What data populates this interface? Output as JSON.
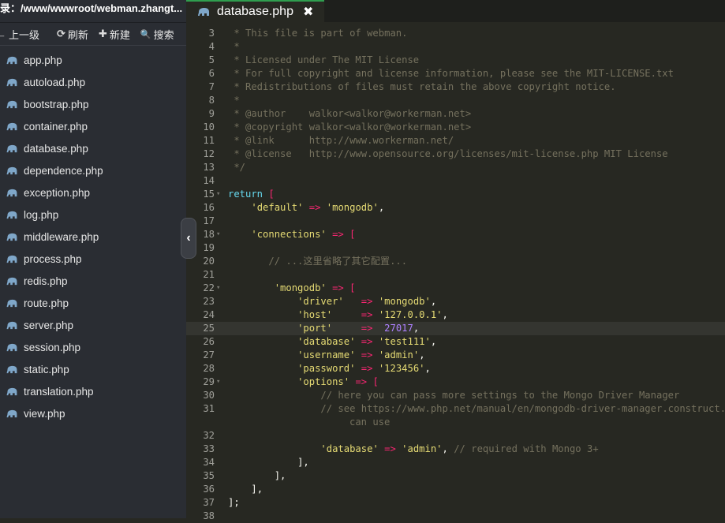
{
  "sidebar": {
    "path": "录：/www/wwwroot/webman.zhangt...",
    "toolbar": [
      {
        "icon": "up-icon",
        "glyph": "←",
        "label": "上一级"
      },
      {
        "icon": "refresh-icon",
        "glyph": "⟳",
        "label": "刷新"
      },
      {
        "icon": "plus-icon",
        "glyph": "✚",
        "label": "新建"
      },
      {
        "icon": "search-icon",
        "glyph": "🔍",
        "label": "搜索"
      }
    ],
    "files": [
      "app.php",
      "autoload.php",
      "bootstrap.php",
      "container.php",
      "database.php",
      "dependence.php",
      "exception.php",
      "log.php",
      "middleware.php",
      "process.php",
      "redis.php",
      "route.php",
      "server.php",
      "session.php",
      "static.php",
      "translation.php",
      "view.php"
    ],
    "collapse_glyph": "‹"
  },
  "editor": {
    "tab_label": "database.php",
    "close_glyph": "✖",
    "active_line": "25",
    "lines": [
      {
        "n": "3",
        "t": [
          [
            "c",
            " * This file is part of webman."
          ]
        ]
      },
      {
        "n": "4",
        "t": [
          [
            "c",
            " *"
          ]
        ]
      },
      {
        "n": "5",
        "t": [
          [
            "c",
            " * Licensed under The MIT License"
          ]
        ]
      },
      {
        "n": "6",
        "t": [
          [
            "c",
            " * For full copyright and license information, please see the MIT-LICENSE.txt"
          ]
        ]
      },
      {
        "n": "7",
        "t": [
          [
            "c",
            " * Redistributions of files must retain the above copyright notice."
          ]
        ]
      },
      {
        "n": "8",
        "t": [
          [
            "c",
            " *"
          ]
        ]
      },
      {
        "n": "9",
        "t": [
          [
            "c",
            " * @author    walkor<walkor@workerman.net>"
          ]
        ]
      },
      {
        "n": "10",
        "t": [
          [
            "c",
            " * @copyright walkor<walkor@workerman.net>"
          ]
        ]
      },
      {
        "n": "11",
        "t": [
          [
            "c",
            " * @link      http://www.workerman.net/"
          ]
        ]
      },
      {
        "n": "12",
        "t": [
          [
            "c",
            " * @license   http://www.opensource.org/licenses/mit-license.php MIT License"
          ]
        ]
      },
      {
        "n": "13",
        "t": [
          [
            "c",
            " */"
          ]
        ]
      },
      {
        "n": "14",
        "t": []
      },
      {
        "n": "15",
        "f": "▾",
        "t": [
          [
            "k",
            "return"
          ],
          [
            "p",
            " "
          ],
          [
            "o",
            "["
          ]
        ]
      },
      {
        "n": "16",
        "t": [
          [
            "p",
            "    "
          ],
          [
            "s",
            "'default'"
          ],
          [
            "p",
            " "
          ],
          [
            "o",
            "=>"
          ],
          [
            "p",
            " "
          ],
          [
            "s",
            "'mongodb'"
          ],
          [
            "p",
            ","
          ]
        ]
      },
      {
        "n": "17",
        "t": []
      },
      {
        "n": "18",
        "f": "▾",
        "t": [
          [
            "p",
            "    "
          ],
          [
            "s",
            "'connections'"
          ],
          [
            "p",
            " "
          ],
          [
            "o",
            "=>"
          ],
          [
            "p",
            " "
          ],
          [
            "o",
            "["
          ]
        ]
      },
      {
        "n": "19",
        "t": []
      },
      {
        "n": "20",
        "t": [
          [
            "p",
            "       "
          ],
          [
            "c",
            "// ...这里省略了其它配置..."
          ]
        ]
      },
      {
        "n": "21",
        "t": []
      },
      {
        "n": "22",
        "f": "▾",
        "t": [
          [
            "p",
            "        "
          ],
          [
            "s",
            "'mongodb'"
          ],
          [
            "p",
            " "
          ],
          [
            "o",
            "=>"
          ],
          [
            "p",
            " "
          ],
          [
            "o",
            "["
          ]
        ]
      },
      {
        "n": "23",
        "t": [
          [
            "p",
            "            "
          ],
          [
            "s",
            "'driver'"
          ],
          [
            "p",
            "   "
          ],
          [
            "o",
            "=>"
          ],
          [
            "p",
            " "
          ],
          [
            "s",
            "'mongodb'"
          ],
          [
            "p",
            ","
          ]
        ]
      },
      {
        "n": "24",
        "t": [
          [
            "p",
            "            "
          ],
          [
            "s",
            "'host'"
          ],
          [
            "p",
            "     "
          ],
          [
            "o",
            "=>"
          ],
          [
            "p",
            " "
          ],
          [
            "s",
            "'127.0.0.1'"
          ],
          [
            "p",
            ","
          ]
        ]
      },
      {
        "n": "25",
        "t": [
          [
            "p",
            "            "
          ],
          [
            "s",
            "'port'"
          ],
          [
            "p",
            "     "
          ],
          [
            "o",
            "=>"
          ],
          [
            "p",
            "  "
          ],
          [
            "n",
            "27017"
          ],
          [
            "p",
            ","
          ]
        ]
      },
      {
        "n": "26",
        "t": [
          [
            "p",
            "            "
          ],
          [
            "s",
            "'database'"
          ],
          [
            "p",
            " "
          ],
          [
            "o",
            "=>"
          ],
          [
            "p",
            " "
          ],
          [
            "s",
            "'test111'"
          ],
          [
            "p",
            ","
          ]
        ]
      },
      {
        "n": "27",
        "t": [
          [
            "p",
            "            "
          ],
          [
            "s",
            "'username'"
          ],
          [
            "p",
            " "
          ],
          [
            "o",
            "=>"
          ],
          [
            "p",
            " "
          ],
          [
            "s",
            "'admin'"
          ],
          [
            "p",
            ","
          ]
        ]
      },
      {
        "n": "28",
        "t": [
          [
            "p",
            "            "
          ],
          [
            "s",
            "'password'"
          ],
          [
            "p",
            " "
          ],
          [
            "o",
            "=>"
          ],
          [
            "p",
            " "
          ],
          [
            "s",
            "'123456'"
          ],
          [
            "p",
            ","
          ]
        ]
      },
      {
        "n": "29",
        "f": "▾",
        "t": [
          [
            "p",
            "            "
          ],
          [
            "s",
            "'options'"
          ],
          [
            "p",
            " "
          ],
          [
            "o",
            "=>"
          ],
          [
            "p",
            " "
          ],
          [
            "o",
            "["
          ]
        ]
      },
      {
        "n": "30",
        "t": [
          [
            "p",
            "                "
          ],
          [
            "c",
            "// here you can pass more settings to the Mongo Driver Manager"
          ]
        ]
      },
      {
        "n": "31",
        "t": [
          [
            "p",
            "                "
          ],
          [
            "c",
            "// see https://www.php.net/manual/en/mongodb-driver-manager.construct.php"
          ]
        ]
      },
      {
        "n": "",
        "w": true,
        "t": [
          [
            "c",
            "can use"
          ]
        ]
      },
      {
        "n": "32",
        "t": []
      },
      {
        "n": "33",
        "t": [
          [
            "p",
            "                "
          ],
          [
            "s",
            "'database'"
          ],
          [
            "p",
            " "
          ],
          [
            "o",
            "=>"
          ],
          [
            "p",
            " "
          ],
          [
            "s",
            "'admin'"
          ],
          [
            "p",
            ", "
          ],
          [
            "c",
            "// required with Mongo 3+"
          ]
        ]
      },
      {
        "n": "34",
        "t": [
          [
            "p",
            "            "
          ],
          [
            "p",
            "],"
          ]
        ]
      },
      {
        "n": "35",
        "t": [
          [
            "p",
            "        "
          ],
          [
            "p",
            "],"
          ]
        ]
      },
      {
        "n": "36",
        "t": [
          [
            "p",
            "    "
          ],
          [
            "p",
            "],"
          ]
        ]
      },
      {
        "n": "37",
        "t": [
          [
            "p",
            "];"
          ]
        ]
      },
      {
        "n": "38",
        "t": []
      }
    ]
  }
}
